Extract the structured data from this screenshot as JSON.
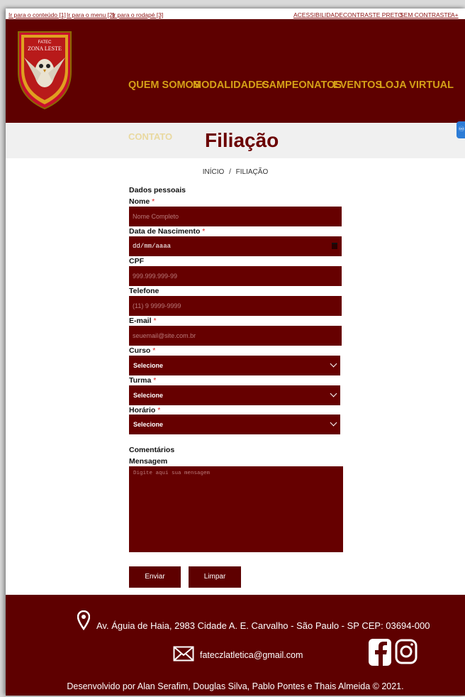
{
  "access_bar": {
    "skip_links": [
      "Ir para o conteúdo [1]",
      "Ir para o menu [2]",
      "Ir para o rodapé [3]"
    ],
    "right_links": [
      "ACESSIBILIDADE",
      "CONTRASTE PRETO",
      "SEM CONTRASTE",
      "A+"
    ]
  },
  "logo": {
    "line1": "FATEC",
    "line2": "ZONA LESTE"
  },
  "nav": {
    "items": [
      "QUEM SOMOS",
      "MODALIDADES",
      "CAMPEONATOS",
      "EVENTOS",
      "LOJA VIRTUAL"
    ],
    "contato": "CONTATO"
  },
  "page_title": "Filiação",
  "breadcrumb": {
    "home": "INÍCIO",
    "sep": "/",
    "current": "FILIAÇÃO"
  },
  "form": {
    "section_personal": "Dados pessoais",
    "fields": {
      "nome": {
        "label": "Nome",
        "placeholder": "Nome Completo"
      },
      "nascimento": {
        "label": "Data de Nascimento",
        "value": "dd/mm/aaaa"
      },
      "cpf": {
        "label": "CPF",
        "placeholder": "999.999.999-99"
      },
      "telefone": {
        "label": "Telefone",
        "placeholder": "(11) 9 9999-9999"
      },
      "email": {
        "label": "E-mail",
        "placeholder": "seuemail@site.com.br"
      },
      "curso": {
        "label": "Curso",
        "value": "Selecione"
      },
      "turma": {
        "label": "Turma",
        "value": "Selecione"
      },
      "horario": {
        "label": "Horário",
        "value": "Selecione"
      }
    },
    "required_mark": "*",
    "section_comments": "Comentários",
    "mensagem": {
      "label": "Mensagem",
      "placeholder": "Digite aqui sua mensagem"
    },
    "submit_label": "Enviar",
    "reset_label": "Limpar"
  },
  "footer": {
    "address": "Av. Águia de Haia, 2983 Cidade A. E. Carvalho - São Paulo - SP CEP: 03694-000",
    "email": "fateczlatletica@gmail.com",
    "credits": "Desenvolvido por Alan Serafim, Douglas Silva, Pablo Pontes e Thais Almeida © 2021."
  },
  "colors": {
    "brand": "#5e0000",
    "field": "#660000",
    "nav_text": "#d4a017"
  }
}
